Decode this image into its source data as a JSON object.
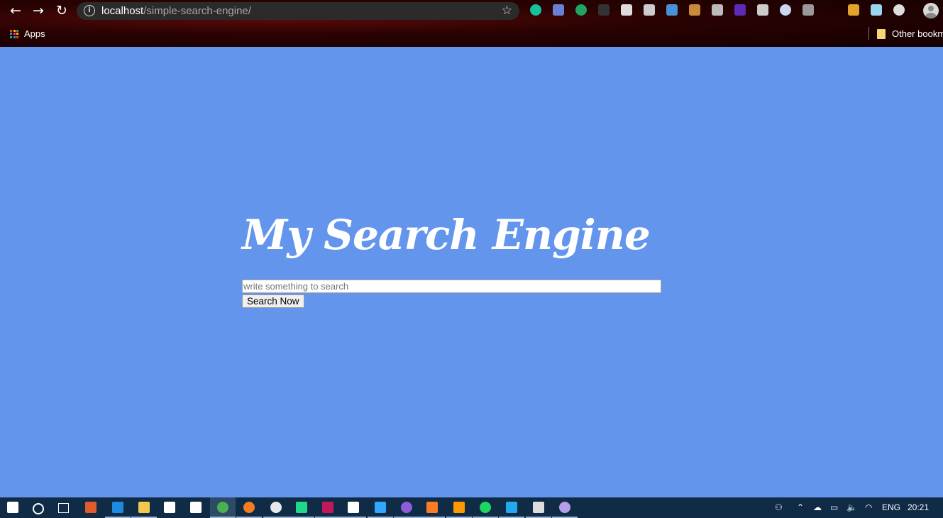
{
  "browser": {
    "url_host": "localhost",
    "url_path": "/simple-search-engine/",
    "nav": {
      "back": "←",
      "forward": "→",
      "reload": "↻"
    },
    "info_glyph": "i",
    "star_glyph": "☆",
    "extensions": [
      {
        "name": "grammarly-icon",
        "color": "#15c39a"
      },
      {
        "name": "camera-icon",
        "color": "#6a7fd6"
      },
      {
        "name": "cart-icon",
        "color": "#20a464"
      },
      {
        "name": "glasses-icon",
        "color": "#333333"
      },
      {
        "name": "layout-icon",
        "color": "#dddddd"
      },
      {
        "name": "incognito-icon",
        "color": "#cccccc"
      },
      {
        "name": "clipboard-icon",
        "color": "#4a90d9"
      },
      {
        "name": "cookie-icon",
        "color": "#c88b3a"
      },
      {
        "name": "r-icon",
        "color": "#bbbbbb"
      },
      {
        "name": "diamond-icon",
        "color": "#5b2bb8"
      },
      {
        "name": "gear-icon",
        "color": "#cccccc"
      },
      {
        "name": "circle-icon",
        "color": "#c9d8f0"
      },
      {
        "name": "pen-icon",
        "color": "#999999"
      },
      {
        "name": "tree-icon",
        "color": "#e2a32a"
      },
      {
        "name": "react-icon",
        "color": "#9ad6f0"
      },
      {
        "name": "target-icon",
        "color": "#dddddd"
      }
    ]
  },
  "bookmarks": {
    "apps_label": "Apps",
    "other_label": "Other bookm"
  },
  "page": {
    "logo_text": "My Search Engine",
    "search_placeholder": "write something to search",
    "search_button": "Search Now",
    "background": "#6495ED"
  },
  "taskbar": {
    "language": "ENG",
    "time": "20:21",
    "apps": [
      {
        "name": "windows-start-icon",
        "color": "#ffffff"
      },
      {
        "name": "cortana-search-icon",
        "color": "#ffffff"
      },
      {
        "name": "task-view-icon",
        "color": "#ffffff"
      },
      {
        "name": "postman-icon",
        "color": "#e05a2a"
      },
      {
        "name": "edge-icon",
        "color": "#1b8ae0"
      },
      {
        "name": "file-explorer-icon",
        "color": "#f2c94c"
      },
      {
        "name": "store-icon",
        "color": "#ffffff"
      },
      {
        "name": "dropbox-icon",
        "color": "#ffffff"
      },
      {
        "name": "chrome-icon",
        "color": "#4caf50"
      },
      {
        "name": "firefox-icon",
        "color": "#f57c1f"
      },
      {
        "name": "app-ring-icon",
        "color": "#e8e8e8"
      },
      {
        "name": "pycharm-icon",
        "color": "#21d789"
      },
      {
        "name": "multicolor-icon",
        "color": "#c2185b"
      },
      {
        "name": "intellij-icon",
        "color": "#ffffff"
      },
      {
        "name": "photoshop-icon",
        "color": "#31a8ff"
      },
      {
        "name": "purple-app-icon",
        "color": "#8e5cd9"
      },
      {
        "name": "xampp-icon",
        "color": "#fb7a24"
      },
      {
        "name": "sublime-icon",
        "color": "#ff9800"
      },
      {
        "name": "spotify-icon",
        "color": "#1ed760"
      },
      {
        "name": "vscode-icon",
        "color": "#23a9f2"
      },
      {
        "name": "terminal-icon",
        "color": "#dddddd"
      },
      {
        "name": "tor-icon",
        "color": "#b59ee8"
      }
    ]
  }
}
